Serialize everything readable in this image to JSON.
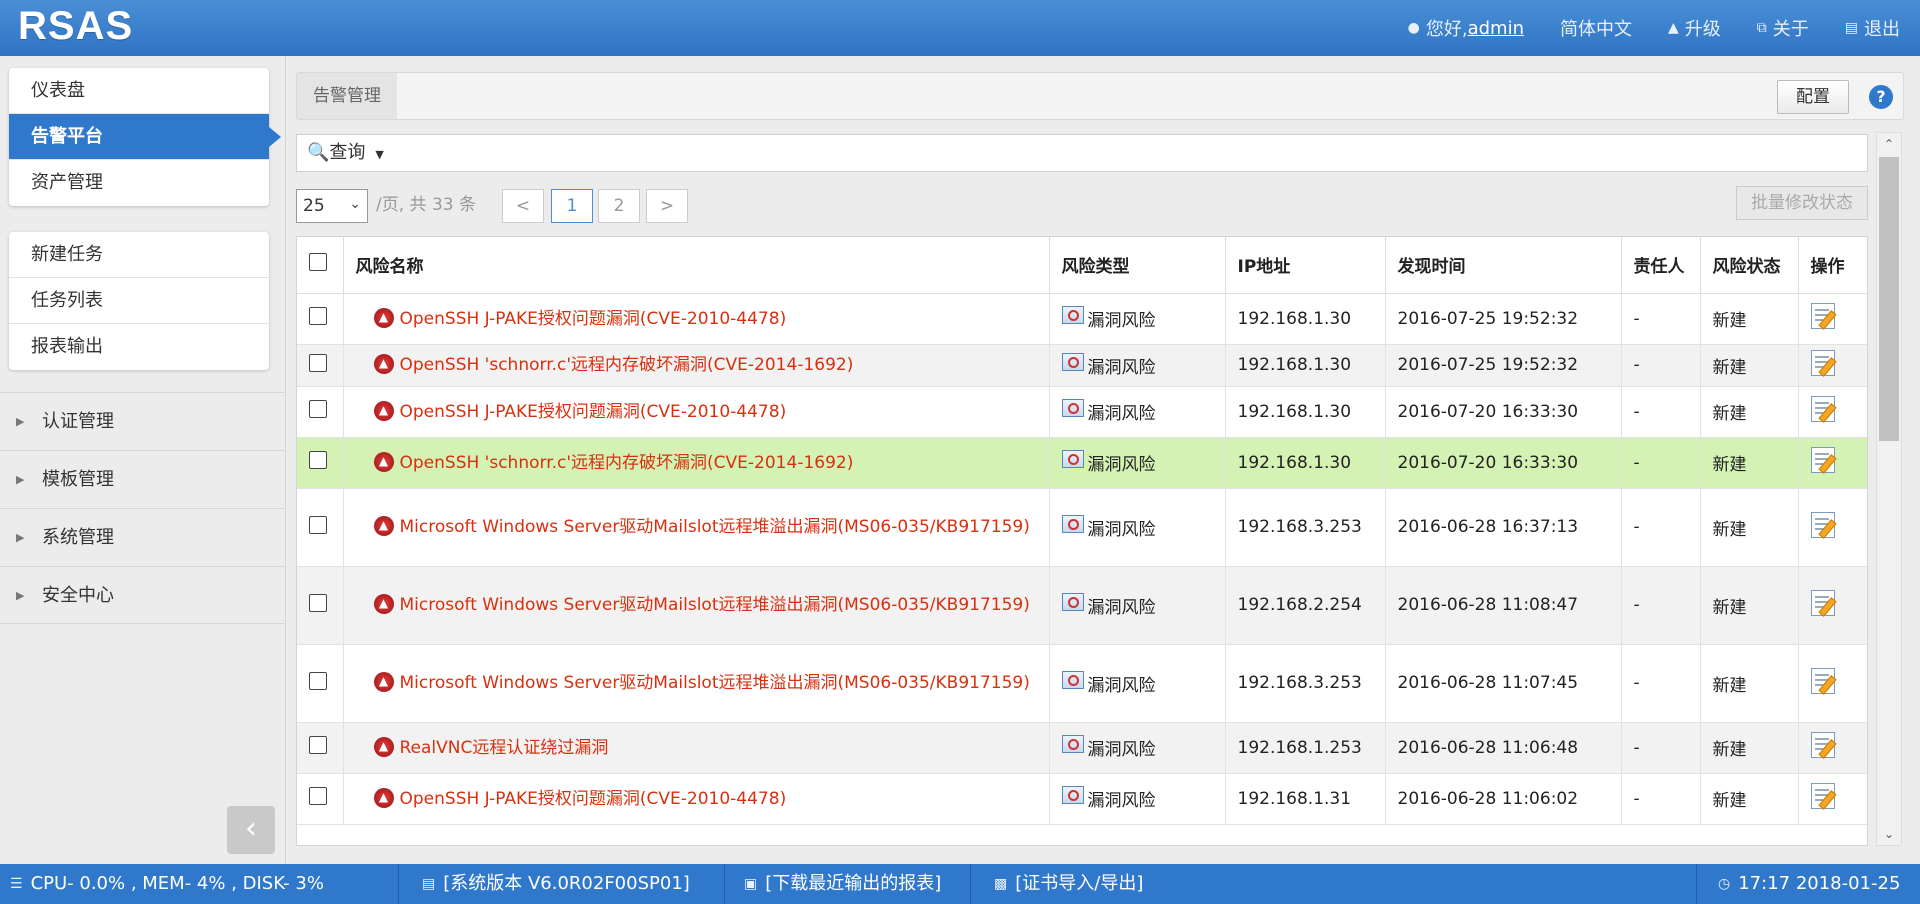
{
  "header": {
    "logo": "RSAS",
    "greeting": "您好,",
    "user": "admin",
    "language": "简体中文",
    "upgrade": "升级",
    "about": "关于",
    "logout": "退出"
  },
  "sidebar": {
    "card1": [
      "仪表盘",
      "告警平台",
      "资产管理"
    ],
    "card2": [
      "新建任务",
      "任务列表",
      "报表输出"
    ],
    "groups": [
      "认证管理",
      "模板管理",
      "系统管理",
      "安全中心"
    ]
  },
  "main": {
    "title": "告警管理",
    "config_label": "配置",
    "help": "?",
    "query_label": "查询",
    "page_size": "25",
    "page_info": "/页, 共 33 条",
    "prev": "<",
    "pages": [
      "1",
      "2"
    ],
    "next": ">",
    "batch_label": "批量修改状态",
    "columns": [
      "风险名称",
      "风险类型",
      "IP地址",
      "发现时间",
      "责任人",
      "风险状态",
      "操作"
    ],
    "rows": [
      {
        "name": "OpenSSH J-PAKE授权问题漏洞(CVE-2010-4478)",
        "type": "漏洞风险",
        "ip": "192.168.1.30",
        "time": "2016-07-25 19:52:32",
        "owner": "-",
        "status": "新建"
      },
      {
        "name": "OpenSSH 'schnorr.c'远程内存破坏漏洞(CVE-2014-1692)",
        "type": "漏洞风险",
        "ip": "192.168.1.30",
        "time": "2016-07-25 19:52:32",
        "owner": "-",
        "status": "新建"
      },
      {
        "name": "OpenSSH J-PAKE授权问题漏洞(CVE-2010-4478)",
        "type": "漏洞风险",
        "ip": "192.168.1.30",
        "time": "2016-07-20 16:33:30",
        "owner": "-",
        "status": "新建"
      },
      {
        "name": "OpenSSH 'schnorr.c'远程内存破坏漏洞(CVE-2014-1692)",
        "type": "漏洞风险",
        "ip": "192.168.1.30",
        "time": "2016-07-20 16:33:30",
        "owner": "-",
        "status": "新建"
      },
      {
        "name": "Microsoft Windows Server驱动Mailslot远程堆溢出漏洞(MS06-035/KB917159)",
        "type": "漏洞风险",
        "ip": "192.168.3.253",
        "time": "2016-06-28 16:37:13",
        "owner": "-",
        "status": "新建"
      },
      {
        "name": "Microsoft Windows Server驱动Mailslot远程堆溢出漏洞(MS06-035/KB917159)",
        "type": "漏洞风险",
        "ip": "192.168.2.254",
        "time": "2016-06-28 11:08:47",
        "owner": "-",
        "status": "新建"
      },
      {
        "name": "Microsoft Windows Server驱动Mailslot远程堆溢出漏洞(MS06-035/KB917159)",
        "type": "漏洞风险",
        "ip": "192.168.3.253",
        "time": "2016-06-28 11:07:45",
        "owner": "-",
        "status": "新建"
      },
      {
        "name": "RealVNC远程认证绕过漏洞",
        "type": "漏洞风险",
        "ip": "192.168.1.253",
        "time": "2016-06-28 11:06:48",
        "owner": "-",
        "status": "新建"
      },
      {
        "name": "OpenSSH J-PAKE授权问题漏洞(CVE-2010-4478)",
        "type": "漏洞风险",
        "ip": "192.168.1.31",
        "time": "2016-06-28 11:06:02",
        "owner": "-",
        "status": "新建"
      }
    ]
  },
  "statusbar": {
    "resources": "CPU-  0.0% , MEM-  4% , DISK-  3%",
    "version": "[系统版本 V6.0R02F00SP01]",
    "download": "[下载最近输出的报表]",
    "cert": "[证书导入/导出]",
    "clock": "17:17 2018-01-25"
  },
  "colors": {
    "brand": "#2f78cc",
    "risk_name": "#d8300f",
    "highlight_row": "#d3f2b3"
  }
}
